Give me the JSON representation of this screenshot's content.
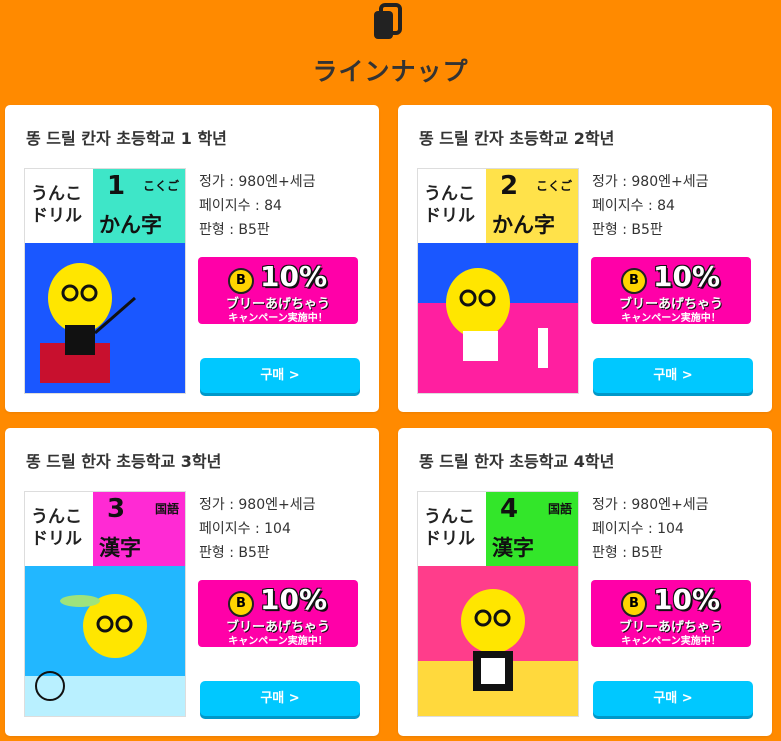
{
  "page": {
    "title": "ラインナップ"
  },
  "labels": {
    "price": "정가 : ",
    "pages": "페이지수 : ",
    "format": "판형 : "
  },
  "promo": {
    "percent": "10%",
    "line1": "ブリーあげちゃう",
    "line2": "キャンペーン実施中！",
    "coin": "B"
  },
  "books": [
    {
      "name": "똥 드릴 칸자 초등학교 1 학년",
      "price": "980엔+세금",
      "pages": "84",
      "format": "B5판",
      "buy_label": "구매 >",
      "cover": {
        "brand": "うんこドリル",
        "grade": "1",
        "subject_tag": "こくご",
        "kanji": "かん字",
        "color": "#3ee6c8",
        "scene_color": "#1a57ff"
      }
    },
    {
      "name": "똥 드릴 칸자 초등학교 2학년",
      "price": "980엔+세금",
      "pages": "84",
      "format": "B5판",
      "buy_label": "구매 >",
      "cover": {
        "brand": "うんこドリル",
        "grade": "2",
        "subject_tag": "こくご",
        "kanji": "かん字",
        "color": "#ffe24a",
        "scene_color": "#ff1fa0"
      }
    },
    {
      "name": "똥 드릴 한자 초등학교 3학년",
      "price": "980엔+세금",
      "pages": "104",
      "format": "B5판",
      "buy_label": "구매 >",
      "cover": {
        "brand": "うんこドリル",
        "grade": "3",
        "subject_tag": "国語",
        "kanji": "漢字",
        "color": "#ff2ad4",
        "scene_color": "#22b7ff"
      }
    },
    {
      "name": "똥 드릴 한자 초등학교 4학년",
      "price": "980엔+세금",
      "pages": "104",
      "format": "B5판",
      "buy_label": "구매 >",
      "cover": {
        "brand": "うんこドリル",
        "grade": "4",
        "subject_tag": "国語",
        "kanji": "漢字",
        "color": "#33e62a",
        "scene_color": "#ff3d8b"
      }
    }
  ]
}
